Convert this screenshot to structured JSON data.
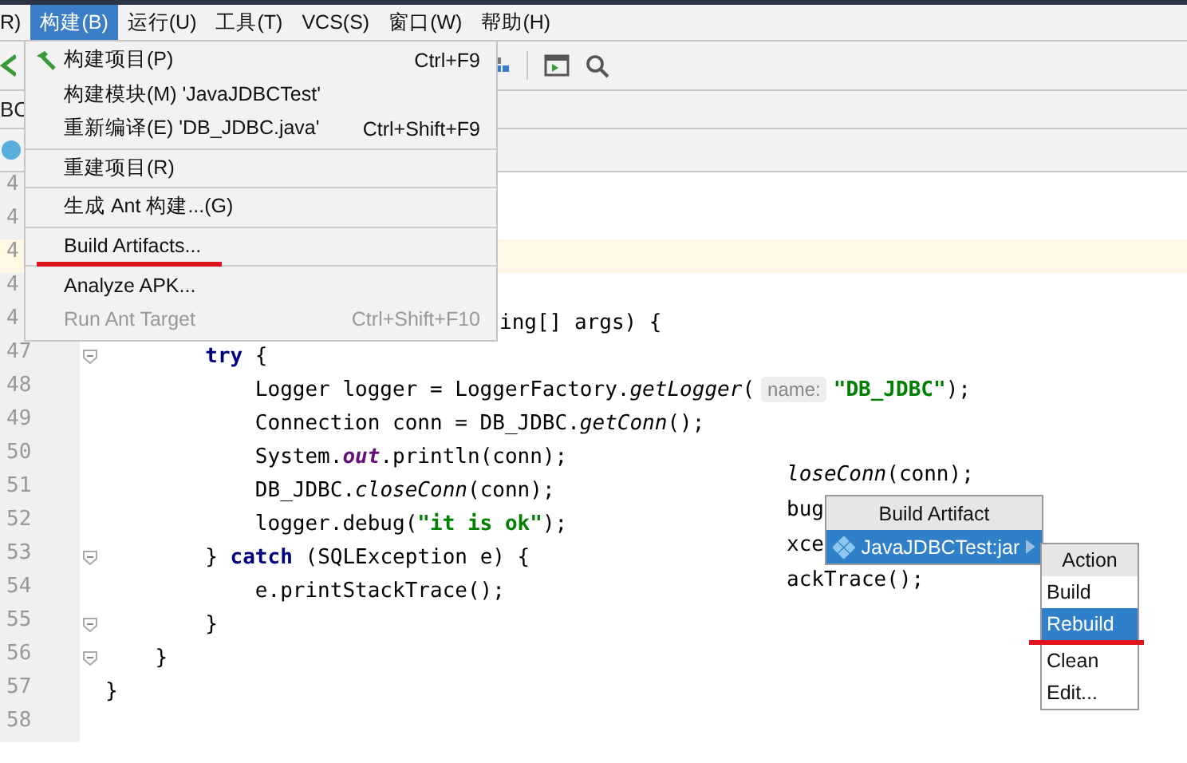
{
  "menubar": {
    "items": [
      {
        "label": "R)",
        "selected": false
      },
      {
        "label": "构建(B)",
        "selected": true
      },
      {
        "label": "运行(U)",
        "selected": false
      },
      {
        "label": "工具(T)",
        "selected": false
      },
      {
        "label": "VCS(S)",
        "selected": false
      },
      {
        "label": "窗口(W)",
        "selected": false
      },
      {
        "label": "帮助(H)",
        "selected": false
      }
    ]
  },
  "tab_fragment": "BC",
  "editor": {
    "lines": [
      {
        "number": "4",
        "current": false
      },
      {
        "number": "4",
        "current": false
      },
      {
        "number": "4",
        "current": true
      },
      {
        "number": "4",
        "current": false
      },
      {
        "number": "4",
        "current": false,
        "kind": "partial",
        "tokens": [
          {
            "text": "ing[] args) {",
            "kind": "plain"
          }
        ]
      },
      {
        "number": "47",
        "current": false,
        "kind": "code",
        "folding": true,
        "tokens": [
          {
            "text": "        try",
            "kind": "keyword"
          },
          {
            "text": " {",
            "kind": "plain"
          }
        ]
      },
      {
        "number": "48",
        "current": false,
        "kind": "code",
        "tokens": [
          {
            "text": "            Logger logger = LoggerFactory.",
            "kind": "plain"
          },
          {
            "text": "getLogger",
            "kind": "italic"
          },
          {
            "text": "(",
            "kind": "plain"
          },
          {
            "text": "name:",
            "kind": "hint"
          },
          {
            "text": "\"DB_JDBC\"",
            "kind": "string"
          },
          {
            "text": ");",
            "kind": "plain"
          }
        ]
      },
      {
        "number": "49",
        "current": false,
        "kind": "code",
        "tokens": [
          {
            "text": "            Connection conn = DB_JDBC.",
            "kind": "plain"
          },
          {
            "text": "getConn",
            "kind": "italic"
          },
          {
            "text": "();",
            "kind": "plain"
          }
        ]
      },
      {
        "number": "50",
        "current": false,
        "kind": "code",
        "tokens": [
          {
            "text": "            System.",
            "kind": "plain"
          },
          {
            "text": "out",
            "kind": "field"
          },
          {
            "text": ".println(conn);",
            "kind": "plain"
          }
        ]
      },
      {
        "number": "51",
        "current": false,
        "kind": "code",
        "tokens": [
          {
            "text": "            DB_JDBC.",
            "kind": "plain"
          },
          {
            "text": "closeConn",
            "kind": "italic"
          },
          {
            "text": "(conn);",
            "kind": "plain"
          }
        ]
      },
      {
        "number": "52",
        "current": false,
        "kind": "code",
        "tokens": [
          {
            "text": "            logger.debug(",
            "kind": "plain"
          },
          {
            "text": "\"it is ok\"",
            "kind": "string"
          },
          {
            "text": ");",
            "kind": "plain"
          }
        ]
      },
      {
        "number": "53",
        "current": false,
        "kind": "code",
        "folding": true,
        "tokens": [
          {
            "text": "        } ",
            "kind": "plain"
          },
          {
            "text": "catch",
            "kind": "keyword"
          },
          {
            "text": " (SQLException e) {",
            "kind": "plain"
          }
        ]
      },
      {
        "number": "54",
        "current": false,
        "kind": "code",
        "tokens": [
          {
            "text": "            e.printStackTrace();",
            "kind": "plain"
          }
        ]
      },
      {
        "number": "55",
        "current": false,
        "kind": "code",
        "folding": true,
        "tokens": [
          {
            "text": "        }",
            "kind": "plain"
          }
        ]
      },
      {
        "number": "56",
        "current": false,
        "kind": "code",
        "folding": true,
        "tokens": [
          {
            "text": "    }",
            "kind": "plain"
          }
        ]
      },
      {
        "number": "57",
        "current": false,
        "kind": "code",
        "tokens": [
          {
            "text": "}",
            "kind": "plain"
          }
        ]
      },
      {
        "number": "58",
        "current": false
      }
    ]
  },
  "overlay_fragment": [
    [
      {
        "text": "loseConn",
        "kind": "italic"
      },
      {
        "text": "(conn);",
        "kind": "plain"
      }
    ],
    [
      {
        "text": "bug",
        "kind": "plain"
      }
    ],
    [
      {
        "text": "xce",
        "kind": "plain"
      }
    ],
    [
      {
        "text": "ackTrace();",
        "kind": "plain"
      }
    ]
  ],
  "build_menu": {
    "items": [
      {
        "kind": "item",
        "label": "构建项目(P)",
        "shortcut": "Ctrl+F9",
        "disabled": false,
        "annotated": false
      },
      {
        "kind": "item",
        "label": "构建模块(M) 'JavaJDBCTest'",
        "disabled": false,
        "annotated": false
      },
      {
        "kind": "item",
        "label": "重新编译(E) 'DB_JDBC.java'",
        "shortcut": "Ctrl+Shift+F9",
        "disabled": false,
        "annotated": false
      },
      {
        "kind": "separator"
      },
      {
        "kind": "item",
        "label": "重建项目(R)",
        "disabled": false,
        "annotated": false
      },
      {
        "kind": "separator"
      },
      {
        "kind": "item",
        "label": "生成 Ant 构建...(G)",
        "disabled": false,
        "annotated": false
      },
      {
        "kind": "separator"
      },
      {
        "kind": "item",
        "label": "Build Artifacts...",
        "disabled": false,
        "annotated": true
      },
      {
        "kind": "separator"
      },
      {
        "kind": "item",
        "label": "Analyze APK...",
        "disabled": false,
        "annotated": false
      },
      {
        "kind": "item",
        "label": "Run Ant Target",
        "shortcut": "Ctrl+Shift+F10",
        "disabled": true,
        "annotated": false
      }
    ]
  },
  "artifact_popup": {
    "title": "Build Artifact",
    "items": [
      {
        "label": "JavaJDBCTest:jar",
        "selected": true
      }
    ]
  },
  "action_popup": {
    "title": "Action",
    "items": [
      {
        "label": "Build",
        "selected": false
      },
      {
        "label": "Rebuild",
        "selected": true
      },
      {
        "label": "Clean",
        "selected": false
      },
      {
        "label": "Edit...",
        "selected": false
      }
    ]
  }
}
